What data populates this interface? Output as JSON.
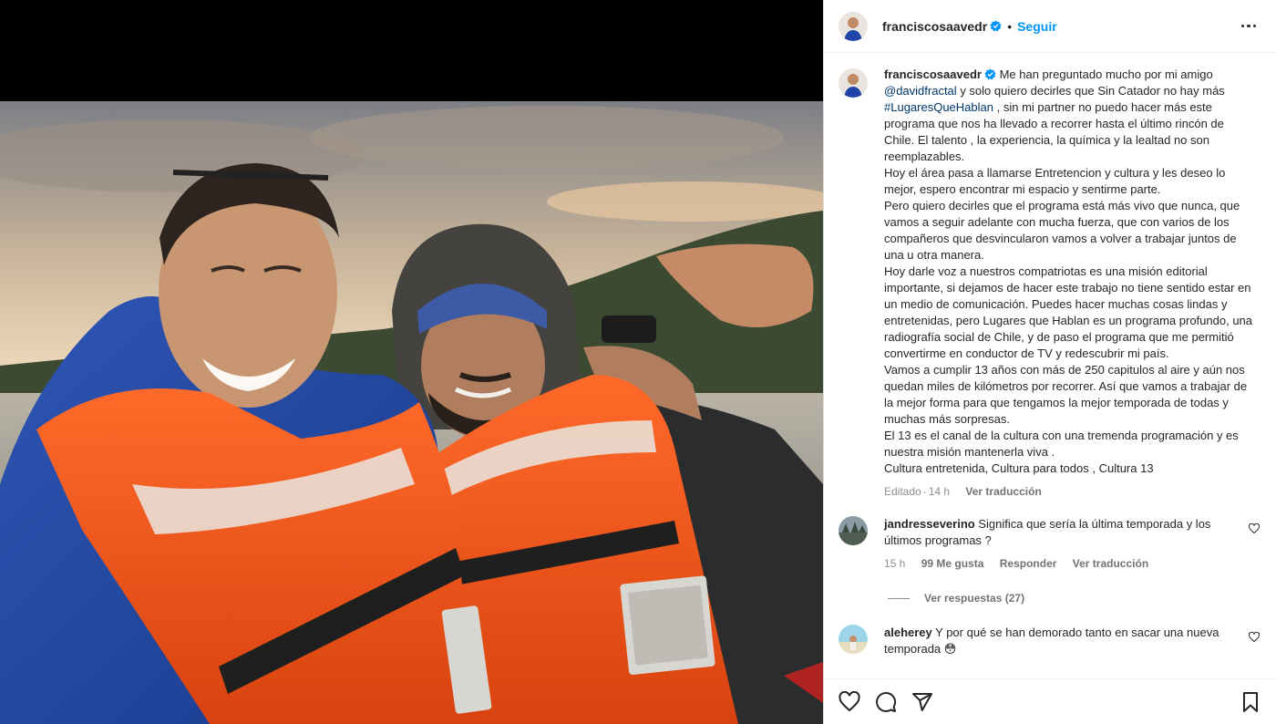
{
  "post": {
    "username": "franciscosaavedr",
    "follow_label": "Seguir",
    "dot": "•",
    "caption": {
      "mention": "@davidfractal",
      "hashtag": "#LugaresQueHablan",
      "part1": "Me han preguntado mucho por mi amigo",
      "part2": "y solo quiero decirles que Sin Catador no hay más",
      "part3": ", sin mi partner no puedo hacer más este programa que nos ha llevado a recorrer hasta el último rincón de Chile. El talento , la experiencia, la química y la lealtad no son reemplazables.",
      "p2": "Hoy el área pasa a llamarse Entretencion y cultura y les deseo lo mejor, espero encontrar mi espacio y sentirme parte.",
      "p3": "Pero quiero decirles que el programa está más vivo que nunca, que vamos a seguir adelante con mucha fuerza, que con varios de los compañeros que desvincularon vamos a volver a trabajar juntos de una u otra manera.",
      "p4": "Hoy darle voz a nuestros compatriotas es una misión editorial importante, si dejamos de hacer este trabajo no tiene sentido estar en un medio de comunicación. Puedes hacer muchas cosas lindas y entretenidas, pero Lugares que Hablan es un programa profundo, una radiografía social de Chile, y de paso el programa que me permitió convertirme en conductor de TV y redescubrir mi país.",
      "p5": "Vamos a cumplir 13 años con más de 250 capitulos al aire y aún nos quedan miles de kilómetros por recorrer. Así que vamos a trabajar de la mejor forma para que tengamos la mejor temporada de todas y muchas más sorpresas.",
      "p6": "El 13 es el canal de la cultura con una tremenda programación y es nuestra misión mantenerla viva .",
      "p7": "Cultura entretenida, Cultura para todos , Cultura 13"
    },
    "meta": {
      "edited": "Editado",
      "sep": "·",
      "time": "14 h",
      "translate": "Ver traducción"
    }
  },
  "comments": [
    {
      "username": "jandresseverino",
      "text": "Significa que sería la última temporada y los últimos programas ?",
      "time": "15 h",
      "likes": "99 Me gusta",
      "reply": "Responder",
      "translate": "Ver traducción",
      "replies_label": "Ver respuestas (27)"
    },
    {
      "username": "aleherey",
      "text": "Y por qué se han demorado tanto en sacar una nueva temporada",
      "emoji": "😳"
    }
  ],
  "icons": {
    "like": "heart-icon",
    "comment": "comment-icon",
    "share": "share-icon",
    "save": "bookmark-icon",
    "more": "more-options-icon",
    "verified": "verified-badge-icon"
  },
  "colors": {
    "link": "#00376b",
    "follow": "#0095f6",
    "verified": "#0095f6",
    "vest": "#f0531c"
  }
}
